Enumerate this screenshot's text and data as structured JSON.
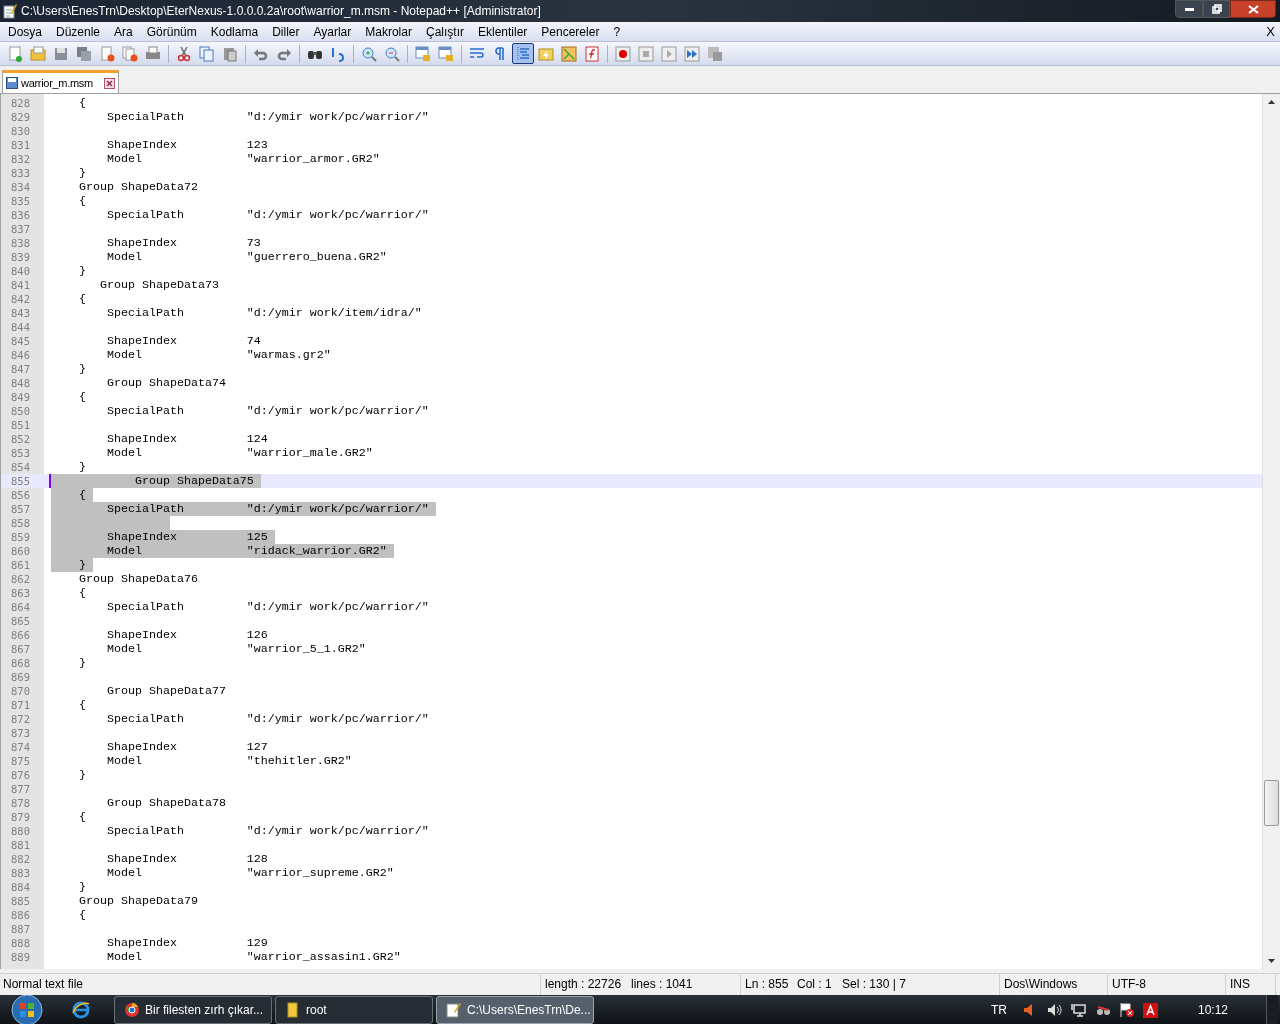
{
  "window": {
    "title": "C:\\Users\\EnesTrn\\Desktop\\EterNexus-1.0.0.0.2a\\root\\warrior_m.msm - Notepad++ [Administrator]"
  },
  "menu": {
    "items": [
      "Dosya",
      "Düzenle",
      "Ara",
      "Görünüm",
      "Kodlama",
      "Diller",
      "Ayarlar",
      "Makrolar",
      "Çalıştır",
      "Eklentiler",
      "Pencereler",
      "?"
    ],
    "close": "X"
  },
  "toolbar": [
    {
      "kind": "new",
      "selected": false
    },
    {
      "kind": "open",
      "selected": false
    },
    {
      "kind": "save",
      "selected": false
    },
    {
      "kind": "saveall",
      "selected": false
    },
    {
      "kind": "close",
      "selected": false
    },
    {
      "kind": "closeall",
      "selected": false
    },
    {
      "kind": "print",
      "selected": false
    },
    {
      "kind": "sep"
    },
    {
      "kind": "cut",
      "selected": false
    },
    {
      "kind": "copy",
      "selected": false
    },
    {
      "kind": "paste",
      "selected": false
    },
    {
      "kind": "sep"
    },
    {
      "kind": "undo",
      "selected": false
    },
    {
      "kind": "redo",
      "selected": false
    },
    {
      "kind": "sep"
    },
    {
      "kind": "find",
      "selected": false
    },
    {
      "kind": "replace",
      "selected": false
    },
    {
      "kind": "sep"
    },
    {
      "kind": "zoomin",
      "selected": false
    },
    {
      "kind": "zoomout",
      "selected": false
    },
    {
      "kind": "sep"
    },
    {
      "kind": "syncv",
      "selected": false
    },
    {
      "kind": "synch",
      "selected": false
    },
    {
      "kind": "sep"
    },
    {
      "kind": "wrap",
      "selected": false
    },
    {
      "kind": "allchars",
      "selected": false
    },
    {
      "kind": "indent",
      "selected": true
    },
    {
      "kind": "udl",
      "selected": false
    },
    {
      "kind": "docmap",
      "selected": false
    },
    {
      "kind": "funclist",
      "selected": false
    },
    {
      "kind": "sep"
    },
    {
      "kind": "record",
      "selected": false
    },
    {
      "kind": "stop",
      "selected": false
    },
    {
      "kind": "play",
      "selected": false
    },
    {
      "kind": "playmulti",
      "selected": false
    },
    {
      "kind": "savemacro",
      "selected": false
    }
  ],
  "tabs": [
    {
      "label": "warrior_m.msm",
      "selected": true
    }
  ],
  "editor": {
    "lines": [
      {
        "number": "828",
        "text": "    {",
        "selected": false,
        "current": false
      },
      {
        "number": "829",
        "text": "        SpecialPath         \"d:/ymir work/pc/warrior/\"",
        "selected": false,
        "current": false
      },
      {
        "number": "830",
        "selected": false,
        "current": false
      },
      {
        "number": "831",
        "text": "        ShapeIndex          123",
        "selected": false,
        "current": false
      },
      {
        "number": "832",
        "text": "        Model               \"warrior_armor.GR2\"",
        "selected": false,
        "current": false
      },
      {
        "number": "833",
        "text": "    }",
        "selected": false,
        "current": false
      },
      {
        "number": "834",
        "text": "    Group ShapeData72",
        "selected": false,
        "current": false
      },
      {
        "number": "835",
        "text": "    {",
        "selected": false,
        "current": false
      },
      {
        "number": "836",
        "text": "        SpecialPath         \"d:/ymir work/pc/warrior/\"",
        "selected": false,
        "current": false
      },
      {
        "number": "837",
        "selected": false,
        "current": false
      },
      {
        "number": "838",
        "text": "        ShapeIndex          73",
        "selected": false,
        "current": false
      },
      {
        "number": "839",
        "text": "        Model               \"guerrero_buena.GR2\"",
        "selected": false,
        "current": false
      },
      {
        "number": "840",
        "text": "    }",
        "selected": false,
        "current": false
      },
      {
        "number": "841",
        "text": "       Group ShapeData73",
        "selected": false,
        "current": false
      },
      {
        "number": "842",
        "text": "    {",
        "selected": false,
        "current": false
      },
      {
        "number": "843",
        "text": "        SpecialPath         \"d:/ymir work/item/idra/\"",
        "selected": false,
        "current": false
      },
      {
        "number": "844",
        "selected": false,
        "current": false
      },
      {
        "number": "845",
        "text": "        ShapeIndex          74",
        "selected": false,
        "current": false
      },
      {
        "number": "846",
        "text": "        Model               \"warmas.gr2\"",
        "selected": false,
        "current": false
      },
      {
        "number": "847",
        "text": "    }",
        "selected": false,
        "current": false
      },
      {
        "number": "848",
        "text": "        Group ShapeData74",
        "selected": false,
        "current": false
      },
      {
        "number": "849",
        "text": "    {",
        "selected": false,
        "current": false
      },
      {
        "number": "850",
        "text": "        SpecialPath         \"d:/ymir work/pc/warrior/\"",
        "selected": false,
        "current": false
      },
      {
        "number": "851",
        "selected": false,
        "current": false
      },
      {
        "number": "852",
        "text": "        ShapeIndex          124",
        "selected": false,
        "current": false
      },
      {
        "number": "853",
        "text": "        Model               \"warrior_male.GR2\"",
        "selected": false,
        "current": false
      },
      {
        "number": "854",
        "text": "    }",
        "selected": false,
        "current": false
      },
      {
        "number": "855",
        "text": "            Group ShapeData75",
        "selected": true,
        "current": true
      },
      {
        "number": "856",
        "text": "    {",
        "selected": true,
        "current": false
      },
      {
        "number": "857",
        "text": "        SpecialPath         \"d:/ymir work/pc/warrior/\"",
        "selected": true,
        "current": false
      },
      {
        "number": "858",
        "selected": true,
        "current": false
      },
      {
        "number": "859",
        "text": "        ShapeIndex          125",
        "selected": true,
        "current": false
      },
      {
        "number": "860",
        "text": "        Model               \"ridack_warrior.GR2\"",
        "selected": true,
        "current": false
      },
      {
        "number": "861",
        "text": "    }",
        "selected": true,
        "current": false
      },
      {
        "number": "862",
        "text": "    Group ShapeData76",
        "selected": false,
        "current": false
      },
      {
        "number": "863",
        "text": "    {",
        "selected": false,
        "current": false
      },
      {
        "number": "864",
        "text": "        SpecialPath         \"d:/ymir work/pc/warrior/\"",
        "selected": false,
        "current": false
      },
      {
        "number": "865",
        "selected": false,
        "current": false
      },
      {
        "number": "866",
        "text": "        ShapeIndex          126",
        "selected": false,
        "current": false
      },
      {
        "number": "867",
        "text": "        Model               \"warrior_5_1.GR2\"",
        "selected": false,
        "current": false
      },
      {
        "number": "868",
        "text": "    }",
        "selected": false,
        "current": false
      },
      {
        "number": "869",
        "selected": false,
        "current": false
      },
      {
        "number": "870",
        "text": "        Group ShapeData77",
        "selected": false,
        "current": false
      },
      {
        "number": "871",
        "text": "    {",
        "selected": false,
        "current": false
      },
      {
        "number": "872",
        "text": "        SpecialPath         \"d:/ymir work/pc/warrior/\"",
        "selected": false,
        "current": false
      },
      {
        "number": "873",
        "selected": false,
        "current": false
      },
      {
        "number": "874",
        "text": "        ShapeIndex          127",
        "selected": false,
        "current": false
      },
      {
        "number": "875",
        "text": "        Model               \"thehitler.GR2\"",
        "selected": false,
        "current": false
      },
      {
        "number": "876",
        "text": "    }",
        "selected": false,
        "current": false
      },
      {
        "number": "877",
        "selected": false,
        "current": false
      },
      {
        "number": "878",
        "text": "        Group ShapeData78",
        "selected": false,
        "current": false
      },
      {
        "number": "879",
        "text": "    {",
        "selected": false,
        "current": false
      },
      {
        "number": "880",
        "text": "        SpecialPath         \"d:/ymir work/pc/warrior/\"",
        "selected": false,
        "current": false
      },
      {
        "number": "881",
        "selected": false,
        "current": false
      },
      {
        "number": "882",
        "text": "        ShapeIndex          128",
        "selected": false,
        "current": false
      },
      {
        "number": "883",
        "text": "        Model               \"warrior_supreme.GR2\"",
        "selected": false,
        "current": false
      },
      {
        "number": "884",
        "text": "    }",
        "selected": false,
        "current": false
      },
      {
        "number": "885",
        "text": "    Group ShapeData79",
        "selected": false,
        "current": false
      },
      {
        "number": "886",
        "text": "    {",
        "selected": false,
        "current": false
      },
      {
        "number": "887",
        "selected": false,
        "current": false
      },
      {
        "number": "888",
        "text": "        ShapeIndex          129",
        "selected": false,
        "current": false
      },
      {
        "number": "889",
        "text": "        Model               \"warrior_assasin1.GR2\"",
        "selected": false,
        "current": false
      }
    ]
  },
  "status_bar": {
    "file_type": "Normal text file",
    "length": "length : 22726",
    "lines": "lines : 1041",
    "ln": "Ln : 855",
    "col": "Col : 1",
    "sel": "Sel : 130 | 7",
    "eol": "Dos\\Windows",
    "encoding": "UTF-8",
    "mode": "INS"
  },
  "taskbar": {
    "buttons": [
      {
        "kind": "browser",
        "label": "Bir filesten zırh çıkar...",
        "selected": false
      },
      {
        "kind": "folder",
        "label": "root",
        "selected": false
      },
      {
        "kind": "notepad",
        "label": "C:\\Users\\EnesTrn\\De...",
        "selected": true
      }
    ],
    "language": "TR",
    "clock": "10:12"
  }
}
